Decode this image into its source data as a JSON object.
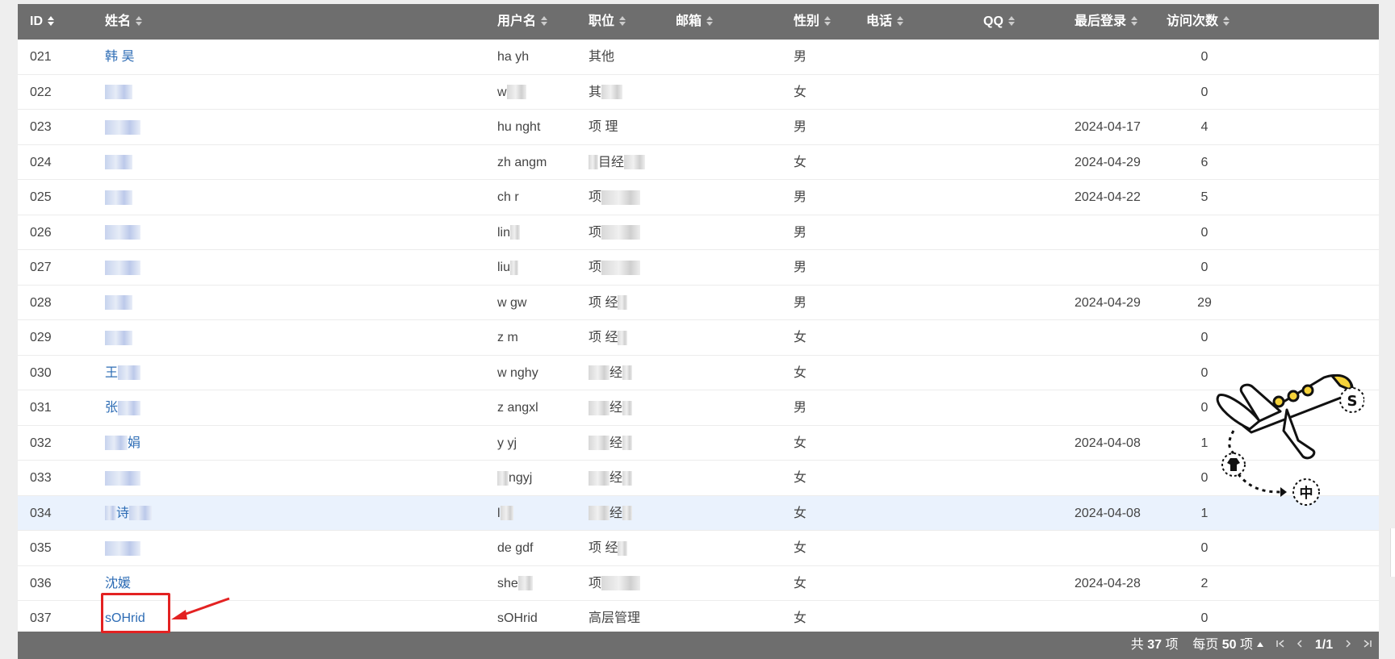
{
  "table": {
    "columns": [
      {
        "label": "ID",
        "sortable": true
      },
      {
        "label": "姓名",
        "sortable": true
      },
      {
        "label": "用户名",
        "sortable": true
      },
      {
        "label": "职位",
        "sortable": true
      },
      {
        "label": "邮箱",
        "sortable": true
      },
      {
        "label": "性别",
        "sortable": true
      },
      {
        "label": "电话",
        "sortable": true
      },
      {
        "label": "QQ",
        "sortable": true
      },
      {
        "label": "最后登录",
        "sortable": true
      },
      {
        "label": "访问次数",
        "sortable": true
      }
    ],
    "rows": [
      {
        "id": "021",
        "name": "韩  昊",
        "username": "ha  yh",
        "position": "其他",
        "gender": "男",
        "last_login": "",
        "visits": "0"
      },
      {
        "id": "022",
        "name": "",
        "username": "w",
        "position": "其",
        "gender": "女",
        "last_login": "",
        "visits": "0"
      },
      {
        "id": "023",
        "name": "",
        "username": "hu  nght",
        "position": "项  理",
        "gender": "男",
        "last_login": "2024-04-17",
        "visits": "4"
      },
      {
        "id": "024",
        "name": "",
        "username": "zh  angm",
        "position": "目经",
        "gender": "女",
        "last_login": "2024-04-29",
        "visits": "6"
      },
      {
        "id": "025",
        "name": "",
        "username": "ch  r",
        "position": "项",
        "gender": "男",
        "last_login": "2024-04-22",
        "visits": "5"
      },
      {
        "id": "026",
        "name": "",
        "username": "lin",
        "position": "项",
        "gender": "男",
        "last_login": "",
        "visits": "0"
      },
      {
        "id": "027",
        "name": "",
        "username": "liu",
        "position": "项",
        "gender": "男",
        "last_login": "",
        "visits": "0"
      },
      {
        "id": "028",
        "name": "",
        "username": "w  gw",
        "position": "项  经",
        "gender": "男",
        "last_login": "2024-04-29",
        "visits": "29"
      },
      {
        "id": "029",
        "name": "",
        "username": "z  m",
        "position": "项  经",
        "gender": "女",
        "last_login": "",
        "visits": "0"
      },
      {
        "id": "030",
        "name": "王",
        "username": "w  nghy",
        "position": "经",
        "gender": "女",
        "last_login": "",
        "visits": "0"
      },
      {
        "id": "031",
        "name": "张",
        "username": "z  angxl",
        "position": "经",
        "gender": "男",
        "last_login": "",
        "visits": "0"
      },
      {
        "id": "032",
        "name": "娟",
        "username": "y  yj",
        "position": "经",
        "gender": "女",
        "last_login": "2024-04-08",
        "visits": "1"
      },
      {
        "id": "033",
        "name": "",
        "username": "ngyj",
        "position": "经",
        "gender": "女",
        "last_login": "",
        "visits": "0"
      },
      {
        "id": "034",
        "name": "诗",
        "username": "l",
        "position": "经",
        "gender": "女",
        "last_login": "2024-04-08",
        "visits": "1"
      },
      {
        "id": "035",
        "name": "",
        "username": "de  gdf",
        "position": "项  经",
        "gender": "女",
        "last_login": "",
        "visits": "0"
      },
      {
        "id": "036",
        "name": "沈媛",
        "username": "she",
        "position": "项",
        "gender": "女",
        "last_login": "2024-04-28",
        "visits": "2"
      },
      {
        "id": "037",
        "name": "sOHrid",
        "username": "sOHrid",
        "position": "高层管理",
        "gender": "女",
        "last_login": "",
        "visits": "0"
      }
    ],
    "highlighted_row": "034"
  },
  "pagination": {
    "total_prefix": "共",
    "total": "37",
    "total_suffix": "项",
    "per_page_prefix": "每页",
    "per_page": "50",
    "per_page_suffix": "项",
    "page": "1/1"
  },
  "overlay": {
    "badge_s": "S",
    "badge_zhong": "中"
  },
  "colors": {
    "header_bg": "#6e6e6e",
    "link": "#2d6cb5",
    "highlight_row": "#eaf2fd",
    "callout_red": "#e32222"
  }
}
